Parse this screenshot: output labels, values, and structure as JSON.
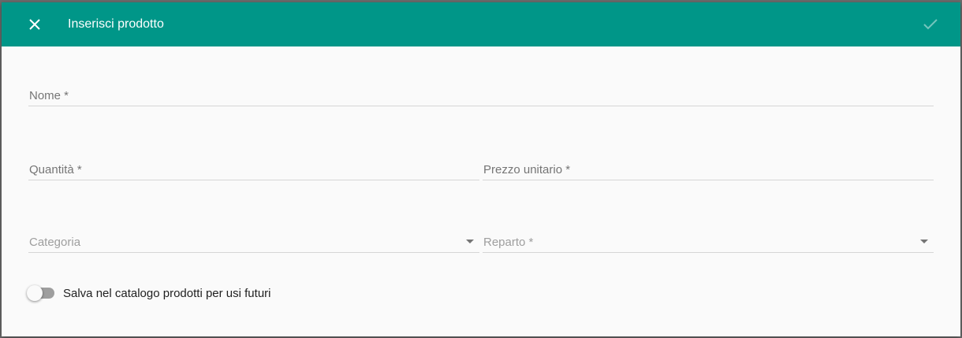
{
  "dialog": {
    "title": "Inserisci prodotto",
    "close_icon": "close-icon",
    "confirm_icon": "check-icon"
  },
  "form": {
    "name": {
      "label": "Nome *",
      "value": ""
    },
    "quantity": {
      "label": "Quantità *",
      "value": ""
    },
    "unit_price": {
      "label": "Prezzo unitario *",
      "value": ""
    },
    "category": {
      "label": "Categoria",
      "value": ""
    },
    "department": {
      "label": "Reparto *",
      "value": ""
    },
    "save_catalog": {
      "label": "Salva nel catalogo prodotti per usi futuri",
      "checked": false
    }
  },
  "colors": {
    "toolbar": "#009688",
    "background": "#fafafa",
    "label": "#757575"
  }
}
